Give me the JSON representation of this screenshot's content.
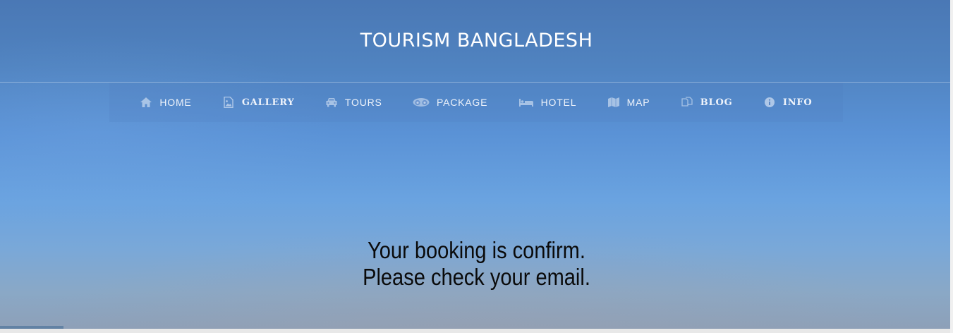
{
  "site": {
    "title": "TOURISM BANGLADESH"
  },
  "nav": {
    "items": [
      {
        "label": "HOME",
        "icon": "home-icon"
      },
      {
        "label": "GALLERY",
        "icon": "image-icon"
      },
      {
        "label": "TOURS",
        "icon": "car-icon"
      },
      {
        "label": "PACKAGE",
        "icon": "binoculars-icon"
      },
      {
        "label": "HOTEL",
        "icon": "bed-icon"
      },
      {
        "label": "MAP",
        "icon": "map-icon"
      },
      {
        "label": "BLOG",
        "icon": "copy-icon"
      },
      {
        "label": "INFO",
        "icon": "info-icon"
      }
    ]
  },
  "message": {
    "line1": "Your booking is confirm.",
    "line2": "Please check your email."
  },
  "colors": {
    "title": "#ffffff",
    "nav_text": "#eef3fb",
    "message_text": "#0a0a0a",
    "sky_top": "#4a78b5",
    "sky_mid": "#6aa3e0"
  }
}
